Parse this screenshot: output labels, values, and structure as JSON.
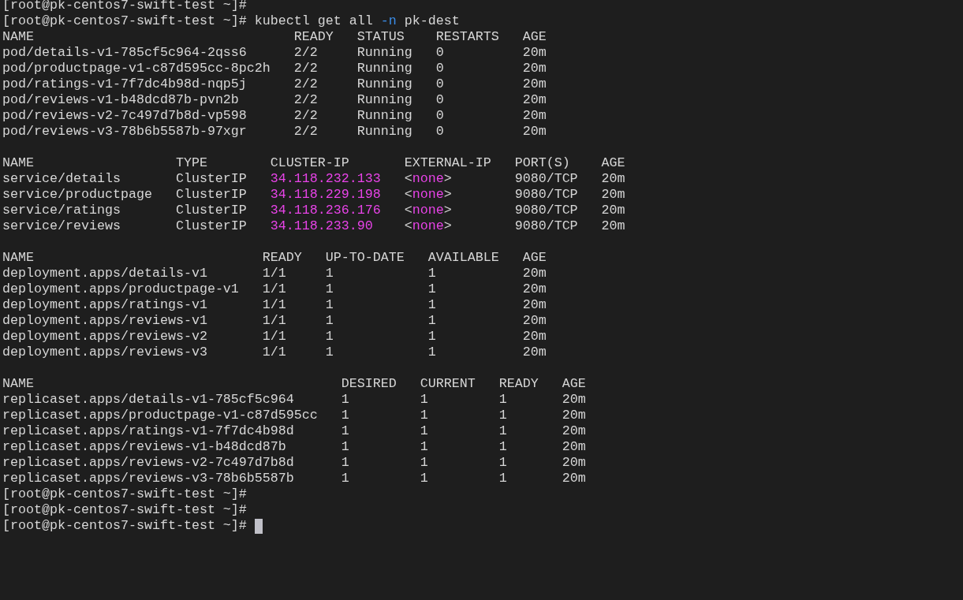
{
  "terminal": {
    "lines_before": [
      {
        "kind": "prompt",
        "prompt": "[root@pk-centos7-swift-test ~]#"
      },
      {
        "kind": "command",
        "prompt": "[root@pk-centos7-swift-test ~]#",
        "command": [
          {
            "text": "kubectl get all "
          },
          {
            "text": "-n",
            "color": "#3b8eea"
          },
          {
            "text": " pk-dest"
          }
        ]
      }
    ],
    "tables": [
      {
        "columns": [
          "NAME",
          "READY",
          "STATUS",
          "RESTARTS",
          "AGE"
        ],
        "rows": [
          [
            "pod/details-v1-785cf5c964-2qss6",
            "2/2",
            "Running",
            "0",
            "20m"
          ],
          [
            "pod/productpage-v1-c87d595cc-8pc2h",
            "2/2",
            "Running",
            "0",
            "20m"
          ],
          [
            "pod/ratings-v1-7f7dc4b98d-nqp5j",
            "2/2",
            "Running",
            "0",
            "20m"
          ],
          [
            "pod/reviews-v1-b48dcd87b-pvn2b",
            "2/2",
            "Running",
            "0",
            "20m"
          ],
          [
            "pod/reviews-v2-7c497d7b8d-vp598",
            "2/2",
            "Running",
            "0",
            "20m"
          ],
          [
            "pod/reviews-v3-78b6b5587b-97xgr",
            "2/2",
            "Running",
            "0",
            "20m"
          ]
        ]
      },
      {
        "columns": [
          "NAME",
          "TYPE",
          "CLUSTER-IP",
          "EXTERNAL-IP",
          "PORT(S)",
          "AGE"
        ],
        "rows": [
          [
            "service/details",
            "ClusterIP",
            [
              {
                "text": "34.118.232.133",
                "color": "#e843e8"
              }
            ],
            [
              {
                "text": "<"
              },
              {
                "text": "none",
                "color": "#e843e8"
              },
              {
                "text": ">"
              }
            ],
            "9080/TCP",
            "20m"
          ],
          [
            "service/productpage",
            "ClusterIP",
            [
              {
                "text": "34.118.229.198",
                "color": "#e843e8"
              }
            ],
            [
              {
                "text": "<"
              },
              {
                "text": "none",
                "color": "#e843e8"
              },
              {
                "text": ">"
              }
            ],
            "9080/TCP",
            "20m"
          ],
          [
            "service/ratings",
            "ClusterIP",
            [
              {
                "text": "34.118.236.176",
                "color": "#e843e8"
              }
            ],
            [
              {
                "text": "<"
              },
              {
                "text": "none",
                "color": "#e843e8"
              },
              {
                "text": ">"
              }
            ],
            "9080/TCP",
            "20m"
          ],
          [
            "service/reviews",
            "ClusterIP",
            [
              {
                "text": "34.118.233.90",
                "color": "#e843e8"
              }
            ],
            [
              {
                "text": "<"
              },
              {
                "text": "none",
                "color": "#e843e8"
              },
              {
                "text": ">"
              }
            ],
            "9080/TCP",
            "20m"
          ]
        ]
      },
      {
        "columns": [
          "NAME",
          "READY",
          "UP-TO-DATE",
          "AVAILABLE",
          "AGE"
        ],
        "rows": [
          [
            "deployment.apps/details-v1",
            "1/1",
            "1",
            "1",
            "20m"
          ],
          [
            "deployment.apps/productpage-v1",
            "1/1",
            "1",
            "1",
            "20m"
          ],
          [
            "deployment.apps/ratings-v1",
            "1/1",
            "1",
            "1",
            "20m"
          ],
          [
            "deployment.apps/reviews-v1",
            "1/1",
            "1",
            "1",
            "20m"
          ],
          [
            "deployment.apps/reviews-v2",
            "1/1",
            "1",
            "1",
            "20m"
          ],
          [
            "deployment.apps/reviews-v3",
            "1/1",
            "1",
            "1",
            "20m"
          ]
        ]
      },
      {
        "columns": [
          "NAME",
          "DESIRED",
          "CURRENT",
          "READY",
          "AGE"
        ],
        "rows": [
          [
            "replicaset.apps/details-v1-785cf5c964",
            "1",
            "1",
            "1",
            "20m"
          ],
          [
            "replicaset.apps/productpage-v1-c87d595cc",
            "1",
            "1",
            "1",
            "20m"
          ],
          [
            "replicaset.apps/ratings-v1-7f7dc4b98d",
            "1",
            "1",
            "1",
            "20m"
          ],
          [
            "replicaset.apps/reviews-v1-b48dcd87b",
            "1",
            "1",
            "1",
            "20m"
          ],
          [
            "replicaset.apps/reviews-v2-7c497d7b8d",
            "1",
            "1",
            "1",
            "20m"
          ],
          [
            "replicaset.apps/reviews-v3-78b6b5587b",
            "1",
            "1",
            "1",
            "20m"
          ]
        ]
      }
    ],
    "lines_after": [
      {
        "kind": "prompt",
        "prompt": "[root@pk-centos7-swift-test ~]#"
      },
      {
        "kind": "prompt",
        "prompt": "[root@pk-centos7-swift-test ~]#"
      },
      {
        "kind": "cursor",
        "prompt": "[root@pk-centos7-swift-test ~]#"
      }
    ]
  }
}
